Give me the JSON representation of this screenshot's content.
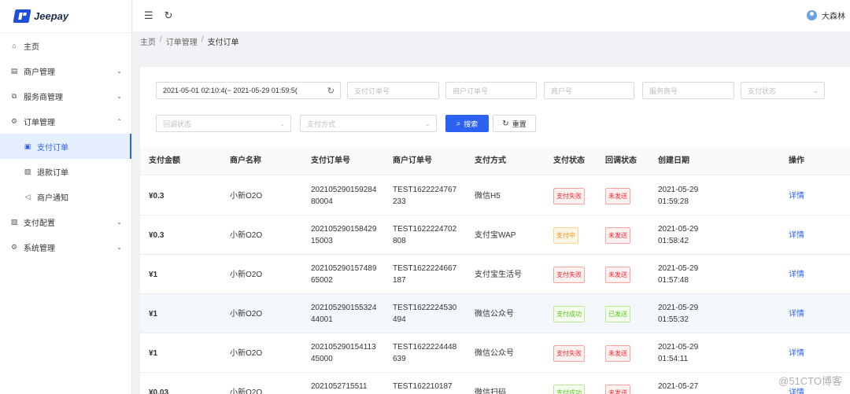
{
  "app": {
    "name": "Jeepay"
  },
  "sidebar": {
    "items": [
      {
        "label": "主页",
        "icon": "home-icon"
      },
      {
        "label": "商户管理",
        "icon": "store-icon",
        "chevron": "⌄"
      },
      {
        "label": "服务商管理",
        "icon": "partner-icon",
        "chevron": "⌄"
      },
      {
        "label": "订单管理",
        "icon": "order-icon",
        "chevron": "⌃"
      },
      {
        "label": "支付订单",
        "icon": "pay-order-icon"
      },
      {
        "label": "退款订单",
        "icon": "refund-icon"
      },
      {
        "label": "商户通知",
        "icon": "notify-icon"
      },
      {
        "label": "支付配置",
        "icon": "pay-config-icon",
        "chevron": "⌄"
      },
      {
        "label": "系统管理",
        "icon": "system-icon",
        "chevron": "⌄"
      }
    ]
  },
  "header": {
    "user_name": "大森林"
  },
  "breadcrumb": {
    "items": [
      "主页",
      "订单管理",
      "支付订单"
    ],
    "sep": "/"
  },
  "filters": {
    "date_range": "2021-05-01 02:10:4(~ 2021-05-29 01:59:5(",
    "pay_order_no": "支付订单号",
    "mch_order_no": "商户订单号",
    "mch_no": "商户号",
    "isv_no": "服务商号",
    "pay_state": "支付状态",
    "notify_state": "回调状态",
    "pay_way": "支付方式",
    "search_btn": "搜索",
    "reset_btn": "重置"
  },
  "table": {
    "headers": [
      "支付金额",
      "商户名称",
      "支付订单号",
      "商户订单号",
      "支付方式",
      "支付状态",
      "回调状态",
      "创建日期",
      "操作"
    ],
    "rows": [
      {
        "amount": "¥0.3",
        "mch": "小新O2O",
        "pay_no": "20210529015928480004",
        "mch_no": "TEST1622224767233",
        "way": "微信H5",
        "pay_state": "支付失败",
        "pay_color": "red",
        "notify": "未发送",
        "notify_color": "red",
        "date": "2021-05-29",
        "time": "01:59:28",
        "op": "详情"
      },
      {
        "amount": "¥0.3",
        "mch": "小新O2O",
        "pay_no": "20210529015842915003",
        "mch_no": "TEST1622224702808",
        "way": "支付宝WAP",
        "pay_state": "支付中",
        "pay_color": "orange",
        "notify": "未发送",
        "notify_color": "red",
        "date": "2021-05-29",
        "time": "01:58:42",
        "op": "详情"
      },
      {
        "amount": "¥1",
        "mch": "小新O2O",
        "pay_no": "20210529015748965002",
        "mch_no": "TEST1622224667187",
        "way": "支付宝生活号",
        "pay_state": "支付失败",
        "pay_color": "red",
        "notify": "未发送",
        "notify_color": "red",
        "date": "2021-05-29",
        "time": "01:57:48",
        "op": "详情"
      },
      {
        "amount": "¥1",
        "mch": "小新O2O",
        "pay_no": "20210529015532444001",
        "mch_no": "TEST1622224530494",
        "way": "微信公众号",
        "pay_state": "支付成功",
        "pay_color": "green",
        "notify": "已发送",
        "notify_color": "green",
        "date": "2021-05-29",
        "time": "01:55:32",
        "op": "详情"
      },
      {
        "amount": "¥1",
        "mch": "小新O2O",
        "pay_no": "20210529015411345000",
        "mch_no": "TEST1622224448639",
        "way": "微信公众号",
        "pay_state": "支付失败",
        "pay_color": "red",
        "notify": "未发送",
        "notify_color": "red",
        "date": "2021-05-29",
        "time": "01:54:11",
        "op": "详情"
      },
      {
        "amount": "¥0.03",
        "mch": "小新O2O",
        "pay_no": "2021052715511",
        "mch_no": "TEST162210187",
        "way": "微信扫码",
        "pay_state": "支付成功",
        "pay_color": "green",
        "notify": "未发送",
        "notify_color": "red",
        "date": "2021-05-27",
        "time": "",
        "op": "详情"
      }
    ]
  },
  "watermark": "@51CTO博客"
}
